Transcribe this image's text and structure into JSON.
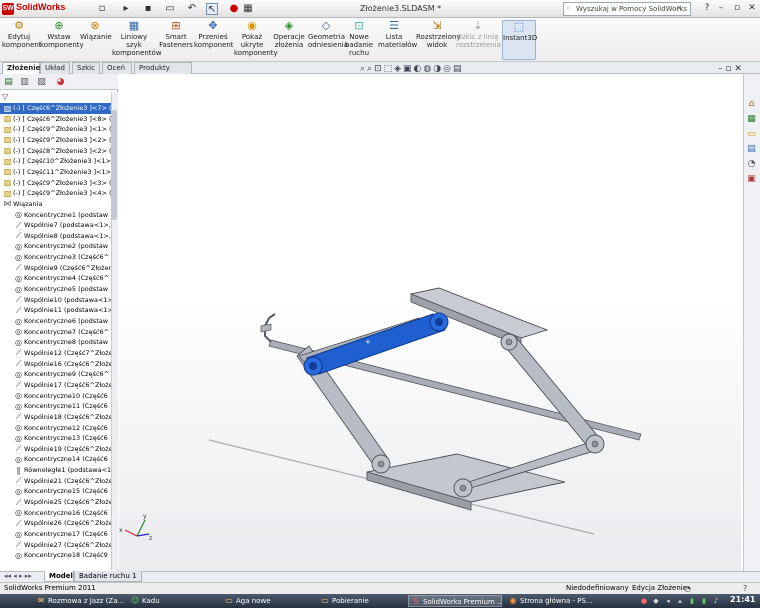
{
  "app": {
    "logo_text": "SolidWorks",
    "document_title": "Złożenie3.SLDASM *",
    "search_placeholder": "Wyszukaj w Pomocy SolidWorks"
  },
  "commands": [
    {
      "label": "Edytuj komponent",
      "icon": "edit-component-icon"
    },
    {
      "label": "Wstaw komponenty",
      "icon": "insert-components-icon"
    },
    {
      "label": "Wiązanie",
      "icon": "mate-icon"
    },
    {
      "label": "Liniowy szyk komponentów",
      "icon": "linear-pattern-icon"
    },
    {
      "label": "Smart Fasteners",
      "icon": "smart-fasteners-icon"
    },
    {
      "label": "Przenieś komponent",
      "icon": "move-component-icon"
    },
    {
      "label": "Pokaż ukryte komponenty",
      "icon": "show-hidden-icon"
    },
    {
      "label": "Operacje złożenia",
      "icon": "assembly-features-icon"
    },
    {
      "label": "Geometria odniesienia",
      "icon": "reference-geometry-icon"
    },
    {
      "label": "Nowe badanie ruchu",
      "icon": "new-motion-study-icon"
    },
    {
      "label": "Lista materiałów",
      "icon": "bom-icon"
    },
    {
      "label": "Rozstrzelony widok",
      "icon": "exploded-view-icon"
    },
    {
      "label": "Szkic z linią rozstrzelenia",
      "icon": "explode-line-sketch-icon"
    },
    {
      "label": "Instant3D",
      "icon": "instant3d-icon"
    }
  ],
  "tabs": [
    "Złożenie",
    "Układ",
    "Szkic",
    "Oceń",
    "Produkty Office"
  ],
  "active_tab": "Złożenie",
  "tree": [
    {
      "text": "(-) [ Część6^Złożenie3 ]<7> (D",
      "icon": "part-icon",
      "selected": true
    },
    {
      "text": "(-) [ Część6^Złożenie3 ]<8> (D",
      "icon": "part-icon"
    },
    {
      "text": "(-) [ Część9^Złożenie3 ]<1> (D",
      "icon": "part-icon"
    },
    {
      "text": "(-) [ Część9^Złożenie3 ]<2> (D",
      "icon": "part-icon"
    },
    {
      "text": "(-) [ Część8^Złożenie3 ]<2> (D",
      "icon": "part-icon"
    },
    {
      "text": "(-) [ Część10^Złożenie3 ]<1> (",
      "icon": "part-icon"
    },
    {
      "text": "(-) [ Część11^Złożenie3 ]<1> (",
      "icon": "part-icon"
    },
    {
      "text": "(-) [ Część9^Złożenie3 ]<3> (D",
      "icon": "part-icon"
    },
    {
      "text": "(-) [ Część9^Złożenie3 ]<4> (D",
      "icon": "part-icon"
    },
    {
      "text": "Wiązania",
      "icon": "mates-folder-icon"
    },
    {
      "text": "Koncentryczne1 (podstaw",
      "icon": "concentric-icon"
    },
    {
      "text": "Wspólnie7 (podstawa<1>,C",
      "icon": "coincident-icon"
    },
    {
      "text": "Wspólnie8 (podstawa<1>,C",
      "icon": "coincident-icon"
    },
    {
      "text": "Koncentryczne2 (podstaw",
      "icon": "concentric-icon"
    },
    {
      "text": "Koncentryczne3 (Część6^",
      "icon": "concentric-icon"
    },
    {
      "text": "Wspólnie9 (Część6^Złożen",
      "icon": "coincident-icon"
    },
    {
      "text": "Koncentryczne4 (Część6^",
      "icon": "concentric-icon"
    },
    {
      "text": "Koncentryczne5 (podstaw",
      "icon": "concentric-icon"
    },
    {
      "text": "Wspólnie10 (podstawa<1>,",
      "icon": "coincident-icon"
    },
    {
      "text": "Wspólnie11 (podstawa<1>,",
      "icon": "coincident-icon"
    },
    {
      "text": "Koncentryczne6 (podstaw",
      "icon": "concentric-icon"
    },
    {
      "text": "Koncentryczne7 (Część6^",
      "icon": "concentric-icon"
    },
    {
      "text": "Koncentryczne8 (podstaw",
      "icon": "concentric-icon"
    },
    {
      "text": "Wspólnie12 (Część7^Złoże",
      "icon": "coincident-icon"
    },
    {
      "text": "Wspólnie16 (Część6^Złoże",
      "icon": "coincident-icon"
    },
    {
      "text": "Koncentryczne9 (Część6^",
      "icon": "concentric-icon"
    },
    {
      "text": "Wspólnie17 (Część6^Złoże",
      "icon": "coincident-icon"
    },
    {
      "text": "Koncentryczne10 (Część6",
      "icon": "concentric-icon"
    },
    {
      "text": "Koncentryczne11 (Część6",
      "icon": "concentric-icon"
    },
    {
      "text": "Wspólnie18 (Część6^Złoże",
      "icon": "coincident-icon"
    },
    {
      "text": "Koncentryczne12 (Część6",
      "icon": "concentric-icon"
    },
    {
      "text": "Koncentryczne13 (Część6",
      "icon": "concentric-icon"
    },
    {
      "text": "Wspólnie19 (Część6^Złoże",
      "icon": "coincident-icon"
    },
    {
      "text": "Koncentryczne14 (Część6",
      "icon": "concentric-icon"
    },
    {
      "text": "Równoległe1 (podstawa<1>",
      "icon": "parallel-icon"
    },
    {
      "text": "Wspólnie21 (Część6^Złoże",
      "icon": "coincident-icon"
    },
    {
      "text": "Koncentryczne15 (Część6",
      "icon": "concentric-icon"
    },
    {
      "text": "Wspólnie25 (Część6^Złoże",
      "icon": "coincident-icon"
    },
    {
      "text": "Koncentryczne16 (Część6",
      "icon": "concentric-icon"
    },
    {
      "text": "Wspólnie26 (Część6^Złoże",
      "icon": "coincident-icon"
    },
    {
      "text": "Koncentryczne17 (Część6",
      "icon": "concentric-icon"
    },
    {
      "text": "Wspólnie27 (Część6^Złoże",
      "icon": "coincident-icon"
    },
    {
      "text": "Koncentryczne18 (Część9",
      "icon": "concentric-icon"
    }
  ],
  "bottom_tabs": [
    "Model",
    "Badanie ruchu 1"
  ],
  "status": {
    "left": "SolidWorks Premium 2011",
    "state": "Niedodefiniowany",
    "mode": "Edycja Złożenie"
  },
  "taskbar": {
    "items": [
      {
        "label": "Rozmowa z Jazz (Za...",
        "icon": "chat-icon"
      },
      {
        "label": "Kadu",
        "icon": "kadu-icon"
      },
      {
        "label": "Aga nowe",
        "icon": "folder-icon"
      },
      {
        "label": "Pobieranie",
        "icon": "download-folder-icon"
      },
      {
        "label": "SolidWorks Premium ...",
        "icon": "solidworks-icon",
        "active": true
      },
      {
        "label": "Strona główna - PS...",
        "icon": "firefox-icon"
      }
    ],
    "clock": "21:41"
  },
  "colors": {
    "accent_selection": "#316ac5",
    "highlight_part": "#1f5fd0",
    "part_gray": "#b8bcc4"
  }
}
